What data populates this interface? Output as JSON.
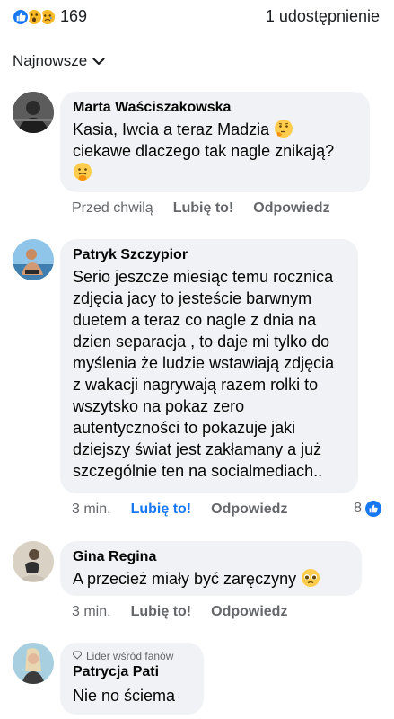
{
  "header": {
    "reaction_count": "169",
    "shares": "1 udostępnienie",
    "reactions": [
      "like-icon",
      "wow-icon",
      "sad-icon"
    ]
  },
  "sort": {
    "label": "Najnowsze"
  },
  "comments": [
    {
      "author": "Marta Waściszakowska",
      "text_lines": [
        "Kasia, Iwcia a teraz Madzia",
        "ciekawe dlaczego tak nagle znikają?"
      ],
      "emojis": [
        "thinking-face-emoji",
        "hushed-face-emoji"
      ],
      "time": "Przed chwilą",
      "like": "Lubię to!",
      "reply": "Odpowiedz"
    },
    {
      "author": "Patryk Szczypior",
      "text_lines": [
        "Serio jeszcze miesiąc temu rocznica",
        "zdjęcia jacy to jesteście barwnym",
        "duetem a teraz co nagle z dnia na",
        "dzien separacja , to daje mi tylko do",
        "myślenia że ludzie wstawiają zdjęcia",
        "z wakacji nagrywają razem rolki to",
        "wszytsko na pokaz zero",
        "autentyczności to pokazuje jaki",
        "dziejszy świat jest zakłamany a już",
        "szczególnie ten na socialmediach.."
      ],
      "time": "3 min.",
      "like": "Lubię to!",
      "reply": "Odpowiedz",
      "like_count": "8"
    },
    {
      "author": "Gina Regina",
      "text_lines": [
        "A przecież miały być zaręczyny"
      ],
      "emojis": [
        "pleading-face-emoji"
      ],
      "time": "3 min.",
      "like": "Lubię to!",
      "reply": "Odpowiedz"
    },
    {
      "badge": "Lider wśród fanów",
      "author": "Patrycja Pati",
      "text_lines": [
        "Nie no ściema"
      ]
    }
  ],
  "colors": {
    "accent": "#1877f2",
    "bubble": "#f0f2f5",
    "muted": "#65676b"
  }
}
